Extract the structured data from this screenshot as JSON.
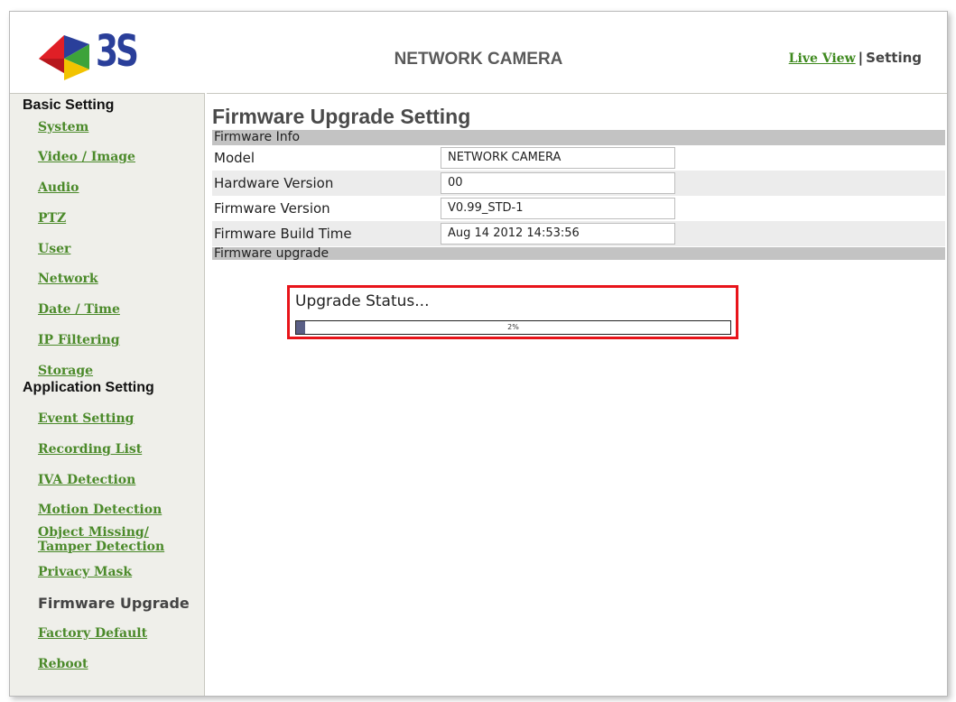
{
  "header": {
    "logo_text": "3S",
    "title": "NETWORK CAMERA",
    "nav": {
      "live_view": "Live View",
      "separator": "|",
      "setting": "Setting"
    }
  },
  "sidebar": {
    "basic_title": "Basic Setting",
    "basic_items": [
      "System",
      "Video / Image",
      "Audio",
      "PTZ",
      "User",
      "Network",
      "Date / Time",
      "IP Filtering",
      "Storage"
    ],
    "app_title": "Application Setting",
    "app_items": [
      "Event Setting",
      "Recording List",
      "IVA Detection",
      "Motion Detection"
    ],
    "object_missing_line1": "Object Missing/",
    "object_missing_line2": "Tamper Detection",
    "privacy_mask": "Privacy Mask",
    "current": "Firmware Upgrade",
    "factory_default": "Factory Default",
    "reboot": "Reboot"
  },
  "main": {
    "page_title": "Firmware Upgrade Setting",
    "info_section": "Firmware Info",
    "fields": [
      {
        "label": "Model",
        "value": "NETWORK CAMERA"
      },
      {
        "label": "Hardware Version",
        "value": "00"
      },
      {
        "label": "Firmware Version",
        "value": "V0.99_STD-1"
      },
      {
        "label": "Firmware Build Time",
        "value": "Aug 14 2012 14:53:56"
      }
    ],
    "upgrade_section": "Firmware upgrade",
    "status_label": "Upgrade Status...",
    "progress_percent": 2,
    "progress_text": "2%"
  },
  "colors": {
    "link": "#4b8a2a",
    "highlight": "#e8141a",
    "progress": "#5a5f86"
  }
}
